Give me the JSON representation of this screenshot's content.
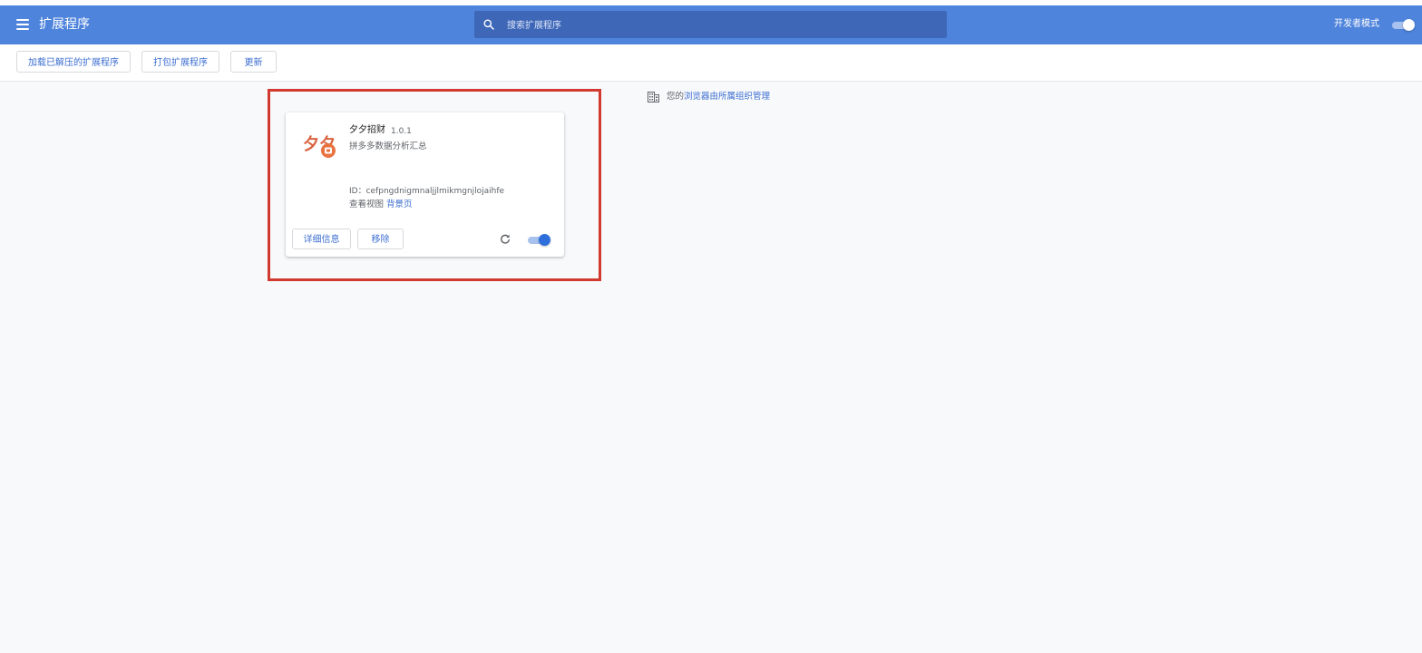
{
  "header": {
    "title": "扩展程序",
    "search_placeholder": "搜索扩展程序",
    "dev_mode_label": "开发者模式",
    "dev_mode_on": true
  },
  "toolbar": {
    "load_unpacked": "加载已解压的扩展程序",
    "pack_extension": "打包扩展程序",
    "update": "更新"
  },
  "managed_notice": {
    "prefix": "您的",
    "link": "浏览器由所属组织管理"
  },
  "extension": {
    "name": "夕夕招财",
    "version": "1.0.1",
    "description": "拼多多数据分析汇总",
    "id_label": "ID：",
    "id_value": "cefpngdnigmnaljjlmikmgnjlojaihfe",
    "views_label": "查看视图",
    "views_link": "背景页",
    "details_button": "详细信息",
    "remove_button": "移除",
    "enabled": true,
    "logo_text": "夕夕",
    "logo_color": "#d9623f"
  },
  "colors": {
    "header_bg": "#4f84dc",
    "search_bg": "#3e67b8",
    "link": "#3d6fd1",
    "highlight_border": "#d2392f",
    "toggle_thumb_on": "#2f6fdc"
  }
}
